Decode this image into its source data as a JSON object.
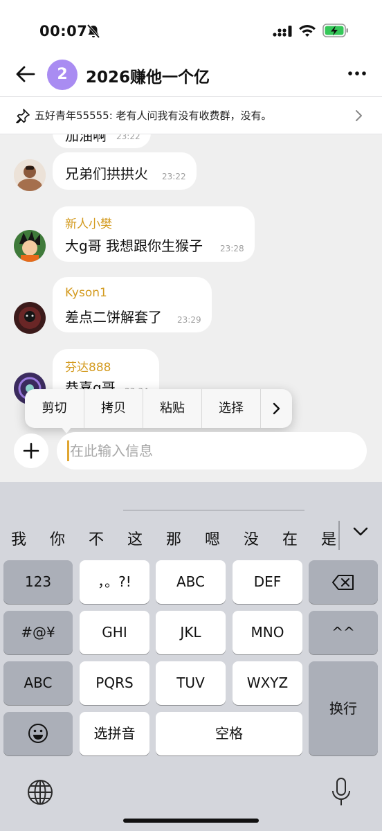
{
  "status_bar": {
    "time": "00:07"
  },
  "header": {
    "group_avatar_text": "2",
    "title": "2026赚他一个亿"
  },
  "pinned": {
    "text": "五好青年55555: 老有人问我有没有收费群，没有。"
  },
  "chat": {
    "partial_message": {
      "text": "加油啊",
      "time": "23:22"
    },
    "messages": [
      {
        "sender": "",
        "text": "兄弟们拱拱火",
        "time": "23:22"
      },
      {
        "sender": "新人小樊",
        "text": "大g哥 我想跟你生猴子",
        "time": "23:28"
      },
      {
        "sender": "Kyson1",
        "text": "差点二饼解套了",
        "time": "23:29"
      },
      {
        "sender": "芬达888",
        "text": "恭喜g哥",
        "time": "23:34"
      }
    ]
  },
  "edit_menu": {
    "items": [
      "剪切",
      "拷贝",
      "粘贴",
      "选择"
    ]
  },
  "input": {
    "placeholder": "在此输入信息"
  },
  "keyboard": {
    "candidates": [
      "我",
      "你",
      "不",
      "这",
      "那",
      "嗯",
      "没",
      "在",
      "是"
    ],
    "keys": {
      "num": "123",
      "punct": "，。?!",
      "abc": "ABC",
      "def": "DEF",
      "sym": "#@¥",
      "ghi": "GHI",
      "jkl": "JKL",
      "mno": "MNO",
      "face": "^^",
      "abc_switch": "ABC",
      "pqrs": "PQRS",
      "tuv": "TUV",
      "wxyz": "WXYZ",
      "pinyin": "选拼音",
      "space": "空格",
      "enter": "换行"
    }
  },
  "colors": {
    "accent": "#a98cf2",
    "sender_name": "#d39a1e",
    "caret": "#e0a632"
  }
}
